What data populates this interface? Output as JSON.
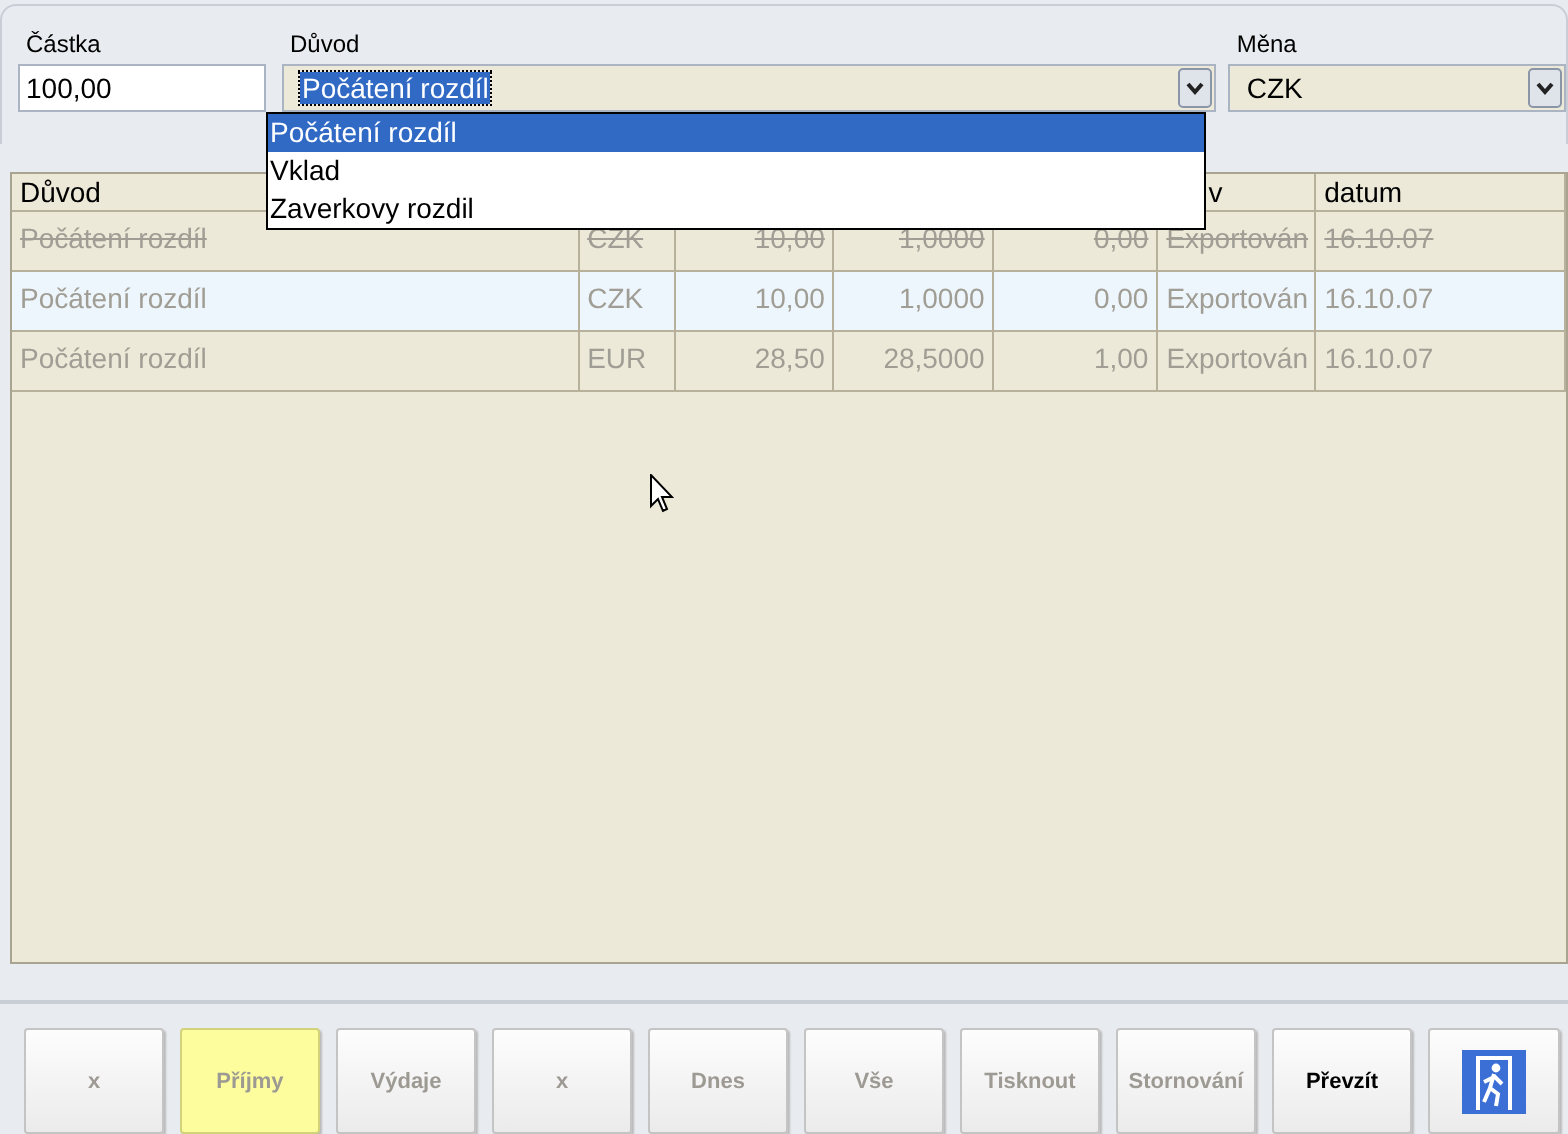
{
  "form": {
    "amount": {
      "label": "Částka",
      "value": "100,00"
    },
    "reason": {
      "label": "Důvod",
      "value": "Počátení rozdíl",
      "expanded": true,
      "options": [
        {
          "label": "Počátení rozdíl",
          "selected": true
        },
        {
          "label": "Vklad",
          "selected": false
        },
        {
          "label": "Zaverkovy rozdil",
          "selected": false
        }
      ]
    },
    "currency": {
      "label": "Měna",
      "value": "CZK"
    }
  },
  "table": {
    "columns": [
      "Důvod",
      null,
      null,
      null,
      null,
      "v",
      "datum"
    ],
    "rows": [
      {
        "cells": [
          "Počátení rozdíl",
          "CZK",
          "10,00",
          "1,0000",
          "0,00",
          "Exportován",
          "16.10.07"
        ],
        "cancelled": true,
        "selected": false
      },
      {
        "cells": [
          "Počátení rozdíl",
          "CZK",
          "10,00",
          "1,0000",
          "0,00",
          "Exportován",
          "16.10.07"
        ],
        "cancelled": false,
        "selected": true
      },
      {
        "cells": [
          "Počátení rozdíl",
          "EUR",
          "28,50",
          "28,5000",
          "1,00",
          "Exportován",
          "16.10.07"
        ],
        "cancelled": false,
        "selected": false
      }
    ]
  },
  "toolbar": [
    {
      "kind": "text",
      "label": "x",
      "selected": false,
      "disabled": true
    },
    {
      "kind": "text",
      "label": "Příjmy",
      "selected": true,
      "disabled": true
    },
    {
      "kind": "text",
      "label": "Výdaje",
      "selected": false,
      "disabled": true
    },
    {
      "kind": "text",
      "label": "x",
      "selected": false,
      "disabled": true
    },
    {
      "kind": "text",
      "label": "Dnes",
      "selected": false,
      "disabled": true
    },
    {
      "kind": "text",
      "label": "Vše",
      "selected": false,
      "disabled": true
    },
    {
      "kind": "text",
      "label": "Tisknout",
      "selected": false,
      "disabled": true
    },
    {
      "kind": "text",
      "label": "Stornování",
      "selected": false,
      "disabled": true
    },
    {
      "kind": "text",
      "label": "Převzít",
      "selected": false,
      "disabled": false
    },
    {
      "kind": "exit",
      "selected": false,
      "disabled": false
    }
  ]
}
